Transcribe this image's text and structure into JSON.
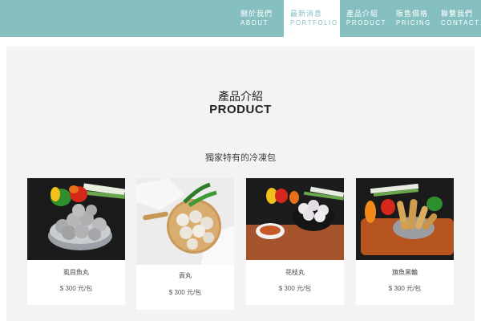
{
  "nav": {
    "items": [
      {
        "zh": "關於我們",
        "en": "ABOUT"
      },
      {
        "zh": "最新消息",
        "en": "PORTFOLIO"
      },
      {
        "zh": "產品介紹",
        "en": "PRODUCT"
      },
      {
        "zh": "販售價格",
        "en": "PRICING"
      },
      {
        "zh": "聯繫我們",
        "en": "CONTACT"
      }
    ],
    "active_index": 1
  },
  "section": {
    "title_zh": "產品介紹",
    "title_en": "PRODUCT",
    "subtitle": "獨家特有的冷凍包"
  },
  "products": [
    {
      "name": "虱目魚丸",
      "price": "$ 300 元/包",
      "image": "fish-balls-bowl"
    },
    {
      "name": "貢丸",
      "price": "$ 300 元/包",
      "image": "meatballs-wooden-board"
    },
    {
      "name": "花枝丸",
      "price": "$ 300 元/包",
      "image": "squid-balls-bowl"
    },
    {
      "name": "旗魚黑輪",
      "price": "$ 300 元/包",
      "image": "fish-cakes-tray"
    }
  ],
  "colors": {
    "accent": "#86bfc0",
    "panel": "#f3f3f3"
  }
}
